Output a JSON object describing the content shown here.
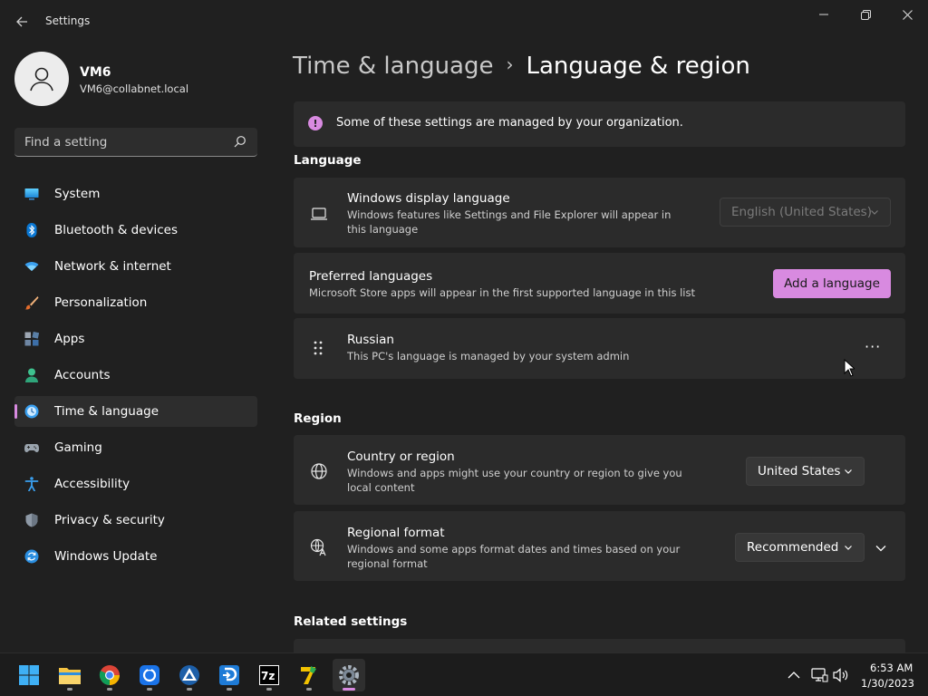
{
  "window": {
    "title": "Settings",
    "controls": [
      "minimize",
      "maximize",
      "close"
    ]
  },
  "user": {
    "name": "VM6",
    "email": "VM6@collabnet.local"
  },
  "search": {
    "placeholder": "Find a setting"
  },
  "sidebar": {
    "items": [
      {
        "label": "System",
        "icon": "system-icon"
      },
      {
        "label": "Bluetooth & devices",
        "icon": "bluetooth-icon"
      },
      {
        "label": "Network & internet",
        "icon": "wifi-icon"
      },
      {
        "label": "Personalization",
        "icon": "brush-icon"
      },
      {
        "label": "Apps",
        "icon": "apps-icon"
      },
      {
        "label": "Accounts",
        "icon": "person-icon"
      },
      {
        "label": "Time & language",
        "icon": "clock-globe-icon",
        "active": true
      },
      {
        "label": "Gaming",
        "icon": "gamepad-icon"
      },
      {
        "label": "Accessibility",
        "icon": "accessibility-icon"
      },
      {
        "label": "Privacy & security",
        "icon": "shield-icon"
      },
      {
        "label": "Windows Update",
        "icon": "update-icon"
      }
    ]
  },
  "breadcrumb": {
    "parent": "Time & language",
    "separator": "›",
    "current": "Language & region"
  },
  "notice": {
    "text": "Some of these settings are managed by your organization."
  },
  "language": {
    "section_title": "Language",
    "display_language": {
      "title": "Windows display language",
      "description": "Windows features like Settings and File Explorer will appear in this language",
      "value": "English (United States)",
      "disabled": true
    },
    "preferred": {
      "title": "Preferred languages",
      "description": "Microsoft Store apps will appear in the first supported language in this list",
      "button": "Add a language"
    },
    "russian": {
      "title": "Russian",
      "description": "This PC's language is managed by your system admin",
      "more": "···"
    }
  },
  "region": {
    "section_title": "Region",
    "country": {
      "title": "Country or region",
      "description": "Windows and apps might use your country or region to give you local content",
      "value": "United States"
    },
    "format": {
      "title": "Regional format",
      "description": "Windows and some apps format dates and times based on your regional format",
      "value": "Recommended"
    }
  },
  "related": {
    "section_title": "Related settings"
  },
  "taskbar": {
    "apps": [
      "start-icon",
      "file-explorer-icon",
      "chrome-icon",
      "app-blue-icon",
      "app-triangle-icon",
      "remote-desktop-icon",
      "7zip-icon",
      "app-7-icon",
      "settings-icon"
    ],
    "time": "6:53 AM",
    "date": "1/30/2023"
  },
  "colors": {
    "accent": "#d88ae0",
    "background": "#202020",
    "card": "#2b2b2b"
  }
}
